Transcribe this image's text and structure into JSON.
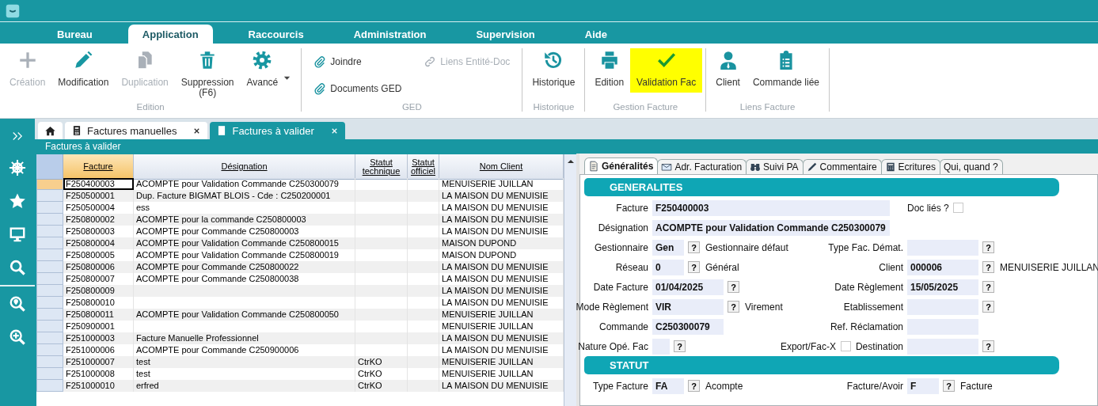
{
  "menu_tabs": [
    {
      "label": "Bureau",
      "selected": false
    },
    {
      "label": "Application",
      "selected": true
    },
    {
      "label": "Raccourcis",
      "selected": false
    },
    {
      "label": "Administration",
      "selected": false
    },
    {
      "label": "Supervision",
      "selected": false
    },
    {
      "label": "Aide",
      "selected": false
    }
  ],
  "ribbon": {
    "groups": [
      {
        "label": "Edition",
        "kind": "large",
        "buttons": [
          {
            "label": "Création",
            "disabled": true,
            "highlighted": false
          },
          {
            "label": "Modification",
            "disabled": false,
            "highlighted": false
          },
          {
            "label": "Duplication",
            "disabled": true,
            "highlighted": false
          },
          {
            "label": "Suppression",
            "shortcut": "(F6)",
            "disabled": false,
            "highlighted": false
          },
          {
            "label": "Avancé",
            "disabled": false,
            "highlighted": false,
            "dropdown": true
          }
        ]
      },
      {
        "label": "GED",
        "kind": "small",
        "buttons": [
          {
            "label": "Joindre",
            "disabled": false,
            "highlighted": false
          },
          {
            "label": "Documents GED",
            "disabled": false,
            "highlighted": false
          },
          {
            "label": "Liens Entité-Doc",
            "disabled": true,
            "highlighted": false
          }
        ]
      },
      {
        "label": "Historique",
        "kind": "large",
        "buttons": [
          {
            "label": "Historique",
            "disabled": false,
            "highlighted": false
          }
        ]
      },
      {
        "label": "Gestion Facture",
        "kind": "large",
        "buttons": [
          {
            "label": "Edition",
            "disabled": false,
            "highlighted": false
          },
          {
            "label": "Validation Fac",
            "disabled": false,
            "highlighted": true
          }
        ]
      },
      {
        "label": "Liens Facture",
        "kind": "large",
        "buttons": [
          {
            "label": "Client",
            "disabled": false,
            "highlighted": false
          },
          {
            "label": "Commande liée",
            "disabled": false,
            "highlighted": false
          }
        ]
      }
    ]
  },
  "doc_tabs": [
    {
      "kind": "home",
      "selected": false
    },
    {
      "kind": "page",
      "label": "Factures manuelles",
      "selected": false
    },
    {
      "kind": "page",
      "label": "Factures à valider",
      "selected": true
    }
  ],
  "view_title": "Factures à valider",
  "grid": {
    "columns": [
      {
        "label": "Facture",
        "sorted": true
      },
      {
        "label": "Désignation",
        "sorted": false
      },
      {
        "label": "Statut technique",
        "sorted": false
      },
      {
        "label": "Statut officiel",
        "sorted": false
      },
      {
        "label": "Nom Client",
        "sorted": false
      }
    ],
    "rows": [
      {
        "selected": true,
        "cells": [
          "F250400003",
          "ACOMPTE pour Validation Commande C250300079",
          null,
          null,
          "MENUISERIE JUILLAN"
        ]
      },
      {
        "selected": false,
        "cells": [
          "F250500001",
          "Dup. Facture BIGMAT BLOIS - Cde : C250200001",
          null,
          null,
          "LA MAISON DU MENUISIE"
        ]
      },
      {
        "selected": false,
        "cells": [
          "F250500004",
          "ess",
          null,
          null,
          "LA MAISON DU MENUISIE"
        ]
      },
      {
        "selected": false,
        "cells": [
          "F250800002",
          "ACOMPTE pour la commande C250800003",
          null,
          null,
          "LA MAISON DU MENUISIE"
        ]
      },
      {
        "selected": false,
        "cells": [
          "F250800003",
          "ACOMPTE pour Commande C250800003",
          null,
          null,
          "LA MAISON DU MENUISIE"
        ]
      },
      {
        "selected": false,
        "cells": [
          "F250800004",
          "ACOMPTE pour Validation Commande C250800015",
          null,
          null,
          "MAISON DUPOND"
        ]
      },
      {
        "selected": false,
        "cells": [
          "F250800005",
          "ACOMPTE pour Validation Commande C250800019",
          null,
          null,
          "MAISON DUPOND"
        ]
      },
      {
        "selected": false,
        "cells": [
          "F250800006",
          "ACOMPTE pour Commande C250800022",
          null,
          null,
          "LA MAISON DU MENUISIE"
        ]
      },
      {
        "selected": false,
        "cells": [
          "F250800007",
          "ACOMPTE pour Commande C250800038",
          null,
          null,
          "LA MAISON DU MENUISIE"
        ]
      },
      {
        "selected": false,
        "cells": [
          "F250800009",
          null,
          null,
          null,
          "LA MAISON DU MENUISIE"
        ]
      },
      {
        "selected": false,
        "cells": [
          "F250800010",
          null,
          null,
          null,
          "LA MAISON DU MENUISIE"
        ]
      },
      {
        "selected": false,
        "cells": [
          "F250800011",
          "ACOMPTE pour Validation Commande C250800050",
          null,
          null,
          "MENUISERIE JUILLAN"
        ]
      },
      {
        "selected": false,
        "cells": [
          "F250900001",
          null,
          null,
          null,
          "MENUISERIE JUILLAN"
        ]
      },
      {
        "selected": false,
        "cells": [
          "F251000003",
          "Facture Manuelle Professionnel",
          null,
          null,
          "LA MAISON DU MENUISIE"
        ]
      },
      {
        "selected": false,
        "cells": [
          "F251000006",
          "ACOMPTE pour Commande C250900006",
          null,
          null,
          "LA MAISON DU MENUISIE"
        ]
      },
      {
        "selected": false,
        "cells": [
          "F251000007",
          "test",
          "CtrKO",
          null,
          "MENUISERIE JUILLAN"
        ]
      },
      {
        "selected": false,
        "cells": [
          "F251000008",
          "test",
          "CtrKO",
          null,
          "MENUISERIE JUILLAN"
        ]
      },
      {
        "selected": false,
        "cells": [
          "F251000010",
          "erfred",
          "CtrKO",
          null,
          "LA MAISON DU MENUISIE"
        ]
      }
    ]
  },
  "form": {
    "tabs": [
      {
        "label": "Généralités",
        "selected": true
      },
      {
        "label": "Adr. Facturation",
        "selected": false
      },
      {
        "label": "Suivi PA",
        "selected": false
      },
      {
        "label": "Commentaire",
        "selected": false
      },
      {
        "label": "Ecritures",
        "selected": false
      },
      {
        "label": "Qui, quand ?",
        "selected": false
      }
    ],
    "sections": [
      {
        "title": "GENERALITES",
        "rows": [
          {
            "left": {
              "label": "Facture",
              "value": "F250400003",
              "kind": "wide"
            },
            "right": {
              "label": "Doc liés ?",
              "kind": "checkbox",
              "checked": false
            }
          },
          {
            "left": {
              "label": "Désignation",
              "value": "ACOMPTE pour Validation Commande C250300079",
              "kind": "wide"
            }
          },
          {
            "left": {
              "label": "Gestionnaire",
              "value": "Gen",
              "kind": "code",
              "help": "?",
              "note": "Gestionnaire défaut"
            },
            "right": {
              "label": "Type Fac. Démat.",
              "kind": "medium",
              "help": "?"
            }
          },
          {
            "left": {
              "label": "Réseau",
              "value": "0",
              "kind": "code",
              "help": "?",
              "note": "Général"
            },
            "right": {
              "label": "Client",
              "value": "000006",
              "kind": "medium",
              "help": "?",
              "note": "MENUISERIE JUILLAN"
            }
          },
          {
            "left": {
              "label": "Date Facture",
              "value": "01/04/2025",
              "kind": "medium",
              "help": "?"
            },
            "right": {
              "label": "Date Règlement",
              "value": "15/05/2025",
              "kind": "medium",
              "help": "?"
            }
          },
          {
            "left": {
              "label": "Mode Règlement",
              "value": "VIR",
              "kind": "medium",
              "help": "?",
              "note": "Virement"
            },
            "right": {
              "label": "Etablissement",
              "kind": "medium",
              "help": "?"
            }
          },
          {
            "left": {
              "label": "Commande",
              "value": "C250300079",
              "kind": "medium"
            },
            "right": {
              "label": "Ref. Réclamation",
              "kind": "medium"
            }
          },
          {
            "left": {
              "label": "Nature Opé. Fac",
              "kind": "tiny",
              "help": "?"
            },
            "right": {
              "label": "Destination",
              "kind": "medium",
              "help": "?",
              "prefix": {
                "label": "Export/Fac-X",
                "kind": "checkbox",
                "checked": false
              }
            }
          }
        ]
      },
      {
        "title": "STATUT",
        "rows": [
          {
            "left": {
              "label": "Type Facture",
              "value": "FA",
              "kind": "code",
              "help": "?",
              "note": "Acompte"
            },
            "right": {
              "label": "Facture/Avoir",
              "value": "F",
              "kind": "code",
              "help": "?",
              "note": "Facture"
            }
          }
        ]
      }
    ]
  }
}
